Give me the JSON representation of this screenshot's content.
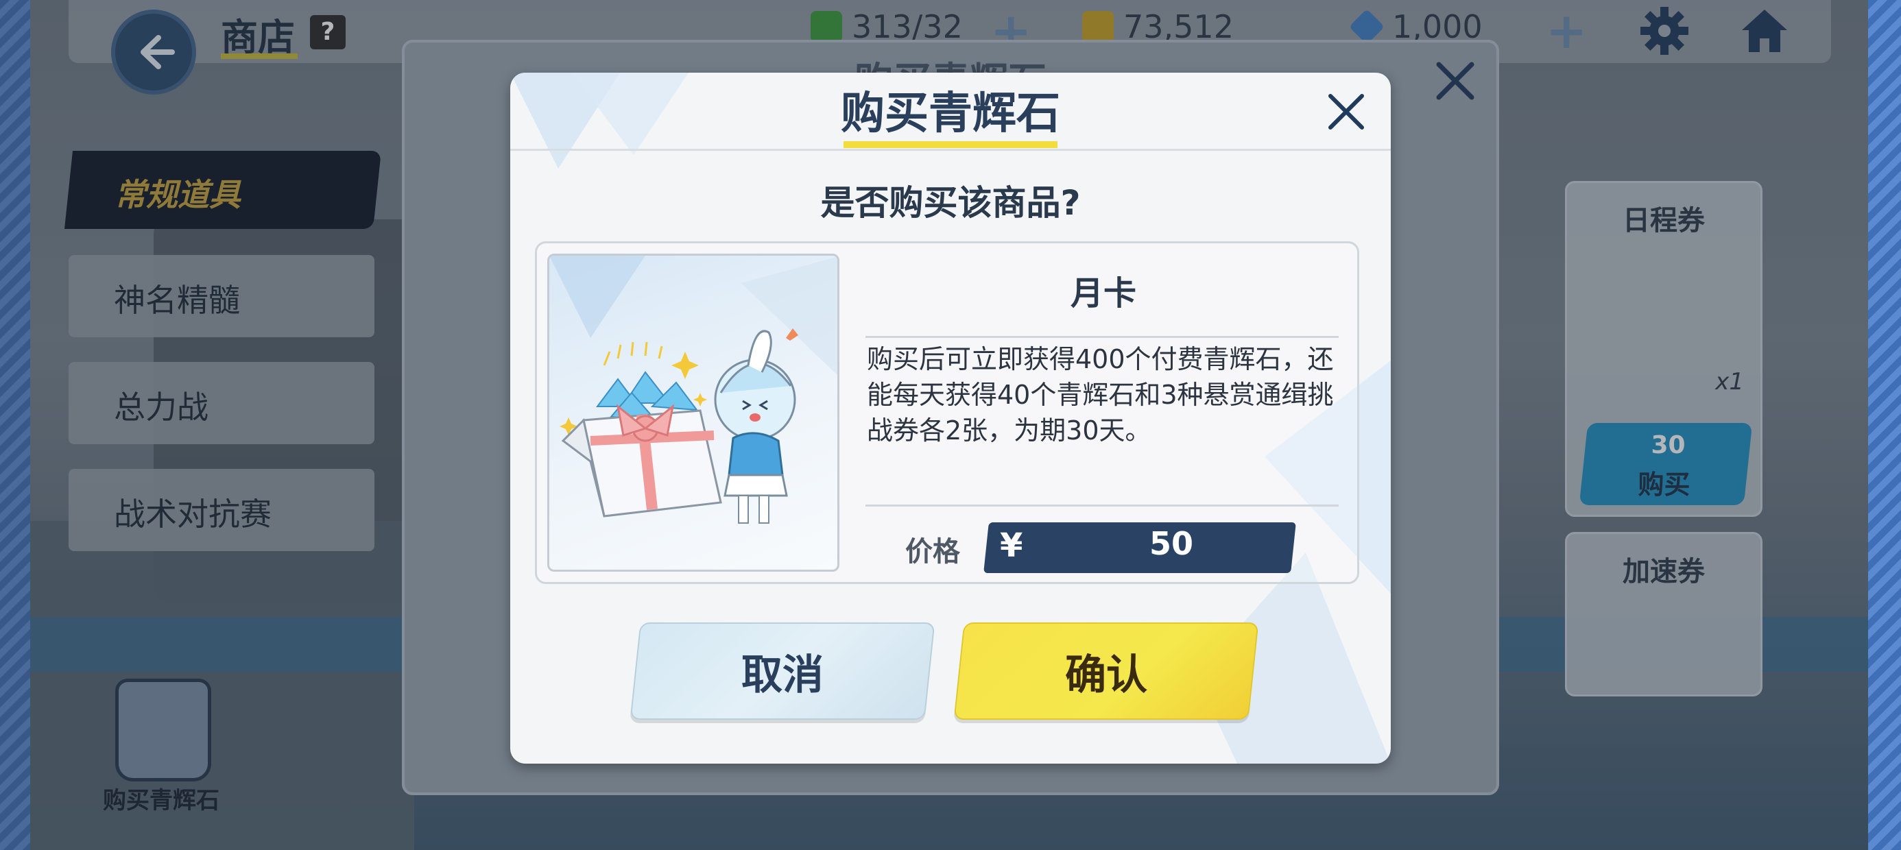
{
  "topbar": {
    "title": "商店",
    "help": "?",
    "resources": [
      {
        "name": "ap",
        "value": "313/32"
      },
      {
        "name": "credits",
        "value": "73,512"
      },
      {
        "name": "pyroxene",
        "value": "1,000"
      }
    ],
    "plus": "+"
  },
  "sidebar": {
    "active": "常规道具",
    "items": [
      {
        "label": "神名精髓"
      },
      {
        "label": "总力战"
      },
      {
        "label": "战术对抗赛"
      }
    ],
    "bottom_label": "购买青辉石"
  },
  "background_panel": {
    "title": "购买青辉石",
    "cards": [
      {
        "title": "日程券",
        "qty": "x1",
        "price": "30",
        "buy": "购买"
      },
      {
        "title": "加速券"
      }
    ]
  },
  "dialog": {
    "title": "购买青辉石",
    "question": "是否购买该商品?",
    "item": {
      "name": "月卡",
      "description": "购买后可立即获得400个付费青辉石，还能每天获得40个青辉石和3种悬赏通缉挑战券各2张，为期30天。"
    },
    "price": {
      "label": "价格",
      "currency_symbol": "¥",
      "value": "50"
    },
    "buttons": {
      "cancel": "取消",
      "confirm": "确认"
    }
  },
  "colors": {
    "accent_yellow": "#f2dd3a",
    "title_blue": "#2a3f5c",
    "price_box": "#2a4364"
  }
}
